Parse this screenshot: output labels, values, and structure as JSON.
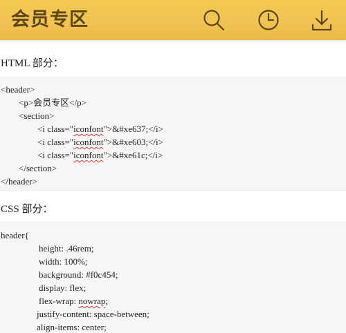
{
  "header": {
    "title": "会员专区",
    "icons": [
      "search-icon",
      "clock-icon",
      "download-icon"
    ],
    "background_color": "#f0c454",
    "title_color": "#5e4514"
  },
  "html_section": {
    "label": "HTML 部分：",
    "lines": {
      "l1": "<header>",
      "l2": "<p>会员专区</p>",
      "l3": "<section>",
      "l4_pre": "<i class=\"",
      "l4_word": "iconfont",
      "l4_post": "\">&#xe637;</i>",
      "l5_pre": "<i class=\"",
      "l5_word": "iconfont",
      "l5_post": "\">&#xe603;</i>",
      "l6_pre": "<i class=\"",
      "l6_word": "iconfont",
      "l6_post": "\">&#xe61c;</i>",
      "l7": "</section>",
      "l8": "</header>"
    }
  },
  "css_section": {
    "label": "CSS 部分：",
    "lines": {
      "l1": "header{",
      "l2": "height: .46rem;",
      "l3": "width: 100%;",
      "l4": "background: #f0c454;",
      "l5": "display: flex;",
      "l6_pre": "flex-wrap: ",
      "l6_word": "nowrap",
      "l6_post": ";",
      "l7": "justify-content: space-between;",
      "l8": "align-items: center;"
    }
  }
}
